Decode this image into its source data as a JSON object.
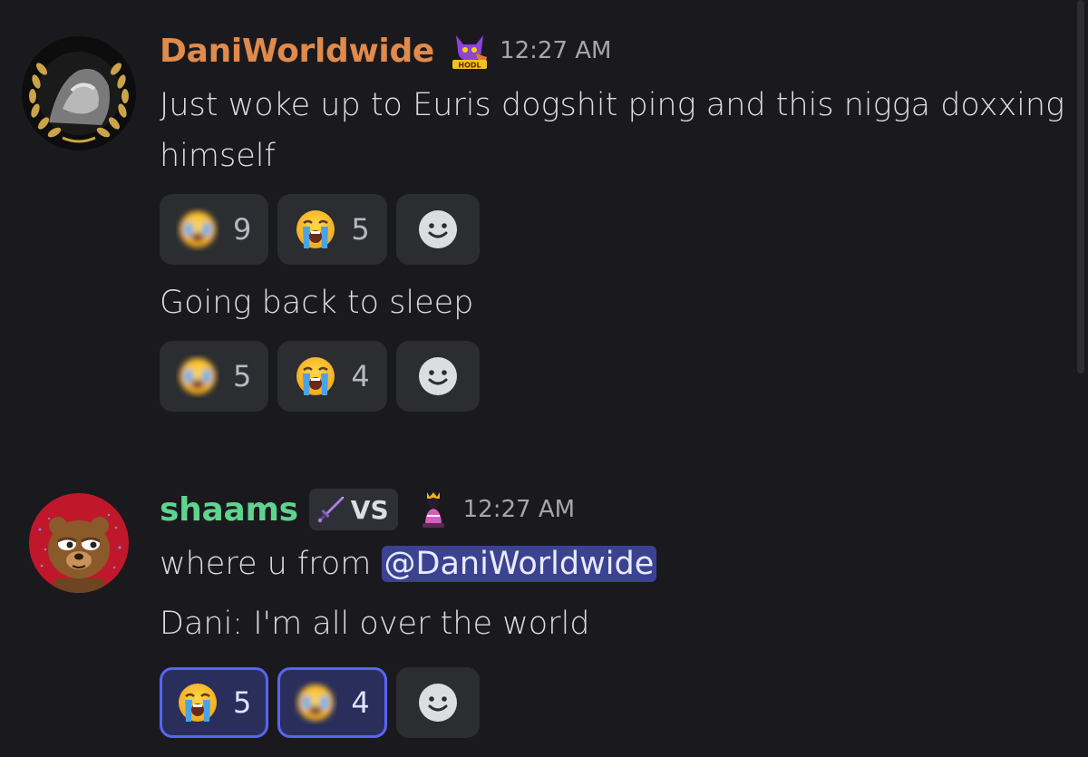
{
  "colors": {
    "background": "#1a1a1e",
    "dani_name": "#e08a4c",
    "shaams_name": "#5fd48f",
    "mention_bg": "#5865f2",
    "reaction_bg": "#2b2d31"
  },
  "messages": [
    {
      "author": "DaniWorldwide",
      "avatar_icon": "laurel-statue-avatar",
      "role_icon": "hodl-cat-icon",
      "timestamp": "12:27 AM",
      "lines": [
        {
          "text": "Just woke up to Euris dogshit ping and this nigga doxxing himself",
          "reactions": [
            {
              "emoji": "blurred-crying-face-icon",
              "count": "9"
            },
            {
              "emoji": "loudly-crying-face-icon",
              "count": "5"
            }
          ]
        },
        {
          "text": "Going back to sleep",
          "reactions": [
            {
              "emoji": "blurred-crying-face-icon",
              "count": "5"
            },
            {
              "emoji": "loudly-crying-face-icon",
              "count": "4"
            }
          ]
        }
      ]
    },
    {
      "author": "shaams",
      "avatar_icon": "pepe-bear-avatar",
      "tag": {
        "icon": "sword-icon",
        "text": "VS"
      },
      "role_icon": "crowned-pawn-icon",
      "timestamp": "12:27 AM",
      "lines": [
        {
          "text_prefix": "where u from ",
          "mention": "@DaniWorldwide"
        },
        {
          "text": "Dani: I'm all over the world",
          "reactions": [
            {
              "emoji": "loudly-crying-face-icon",
              "count": "5"
            },
            {
              "emoji": "blurred-crying-face-icon",
              "count": "4"
            }
          ]
        }
      ]
    }
  ]
}
